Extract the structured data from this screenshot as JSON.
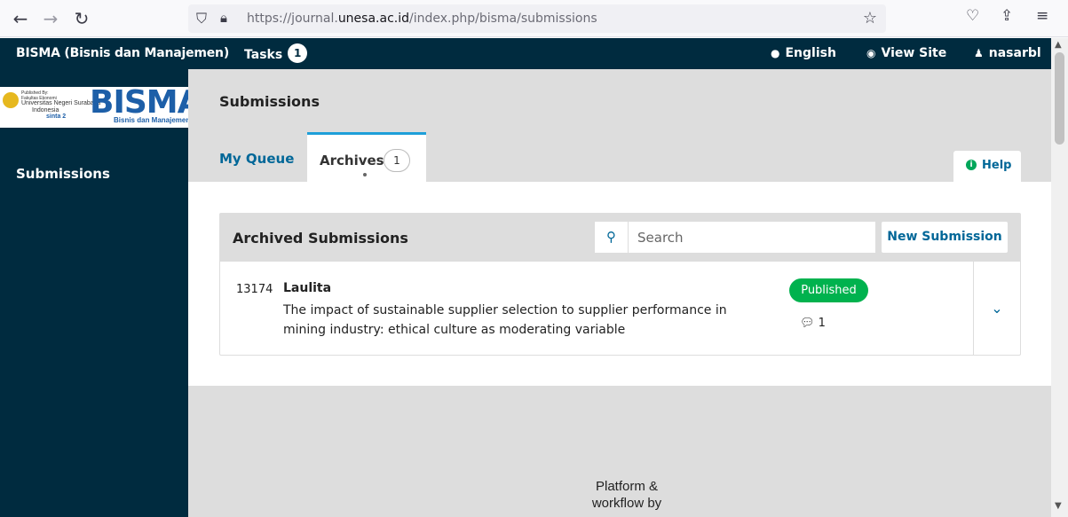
{
  "browser": {
    "url_prefix": "https://journal.",
    "url_domain": "unesa.ac.id",
    "url_path": "/index.php/bisma/submissions"
  },
  "header": {
    "app_title": "BISMA (Bisnis dan Manajemen)",
    "tasks_label": "Tasks",
    "tasks_count": "1",
    "language": "English",
    "view_site": "View Site",
    "username": "nasarbl"
  },
  "sidebar": {
    "logo": {
      "published_by": "Published By:",
      "faculty": "Fakultas Ekonomi",
      "university": "Universitas Negeri Surabaya",
      "country": "Indonesia",
      "title": "BISMA",
      "subtitle": "Bisnis dan Manajemen",
      "sinta": "sinta 2"
    },
    "nav_item": "Submissions"
  },
  "main": {
    "page_title": "Submissions",
    "tabs": [
      {
        "label": "My Queue"
      },
      {
        "label": "Archives",
        "count": "1"
      }
    ],
    "help_label": "Help",
    "grid": {
      "title": "Archived Submissions",
      "search_placeholder": "Search",
      "new_submission": "New Submission",
      "rows": [
        {
          "id": "13174",
          "author": "Laulita",
          "title": "The impact of sustainable supplier selection to supplier performance in mining industry: ethical culture as moderating variable",
          "status": "Published",
          "comments": "1"
        }
      ]
    },
    "footer_text": "Platform & workflow by"
  },
  "colors": {
    "header_bg": "#002b3f",
    "link": "#006798",
    "status_published": "#00b24e",
    "tab_accent": "#1e9fd9"
  }
}
